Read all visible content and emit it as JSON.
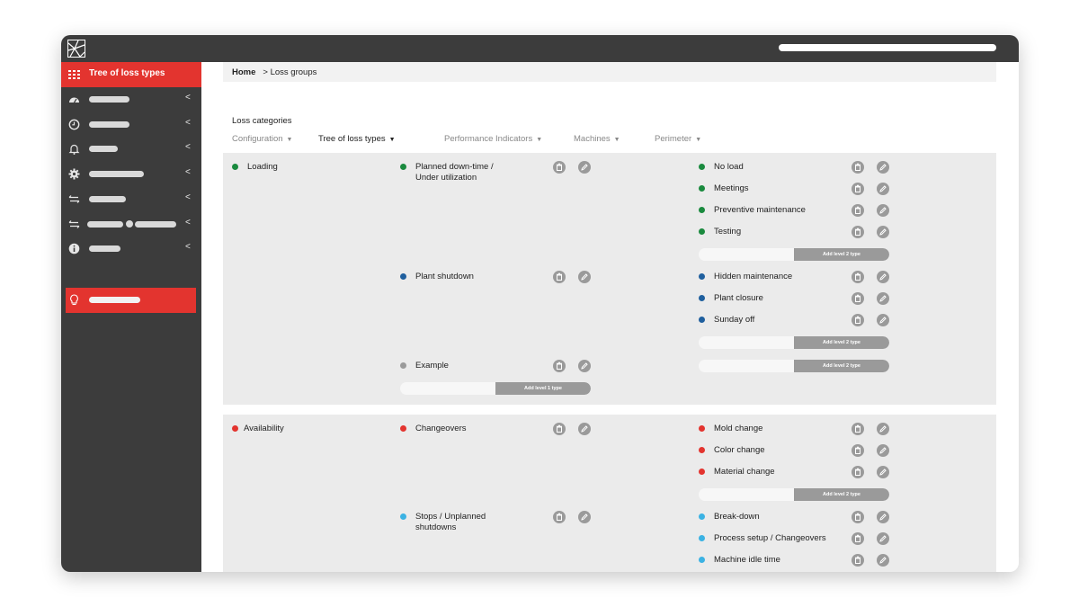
{
  "colors": {
    "accent": "#e3342f",
    "dark": "#3c3c3c",
    "panel": "#ebebeb",
    "green": "#1a8a3e",
    "blue": "#1f5f9e",
    "grey": "#9a9a9a",
    "red": "#e3342f",
    "light_blue": "#3bb2e3"
  },
  "sidebar": {
    "active_top_label": "Tree of loss types",
    "items": [
      {
        "icon": "speedometer-icon"
      },
      {
        "icon": "clock-icon"
      },
      {
        "icon": "bell-icon"
      },
      {
        "icon": "gear-icon"
      },
      {
        "icon": "swap-icon"
      },
      {
        "icon": "swap-icon"
      },
      {
        "icon": "info-icon"
      }
    ],
    "active_bottom_icon": "lightbulb-icon"
  },
  "breadcrumb": {
    "home": "Home",
    "current": "> Loss groups"
  },
  "section_title": "Loss categories",
  "tabs": [
    "Configuration",
    "Tree of loss types",
    "Performance Indicators",
    "Machines",
    "Perimeter"
  ],
  "add_level1": "Add level 1 type",
  "add_level2": "Add level 2 type",
  "groups": [
    {
      "name": "Loading",
      "level1": [
        {
          "name": "Planned down-time /",
          "name2": "Under utilization",
          "level2": [
            "No load",
            "Meetings",
            "Preventive maintenance",
            "Testing"
          ]
        },
        {
          "name": "Plant shutdown",
          "level2": [
            "Hidden maintenance",
            "Plant closure",
            "Sunday off"
          ]
        },
        {
          "name": "Example",
          "level2": []
        }
      ]
    },
    {
      "name": "Availability",
      "level1": [
        {
          "name": "Changeovers",
          "level2": [
            "Mold change",
            "Color change",
            "Material change"
          ]
        },
        {
          "name": "Stops / Unplanned",
          "name2": "shutdowns",
          "level2": [
            "Break-down",
            "Process setup / Changeovers",
            "Machine idle time"
          ]
        }
      ]
    }
  ]
}
